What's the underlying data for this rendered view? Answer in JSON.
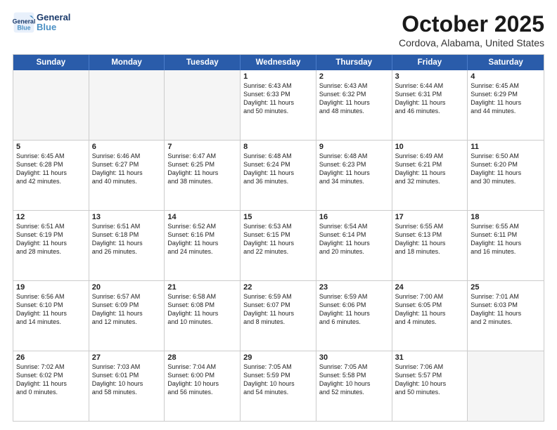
{
  "header": {
    "logo_line1": "General",
    "logo_line2": "Blue",
    "month": "October 2025",
    "location": "Cordova, Alabama, United States"
  },
  "days_of_week": [
    "Sunday",
    "Monday",
    "Tuesday",
    "Wednesday",
    "Thursday",
    "Friday",
    "Saturday"
  ],
  "weeks": [
    [
      {
        "day": "",
        "info": ""
      },
      {
        "day": "",
        "info": ""
      },
      {
        "day": "",
        "info": ""
      },
      {
        "day": "1",
        "info": "Sunrise: 6:43 AM\nSunset: 6:33 PM\nDaylight: 11 hours\nand 50 minutes."
      },
      {
        "day": "2",
        "info": "Sunrise: 6:43 AM\nSunset: 6:32 PM\nDaylight: 11 hours\nand 48 minutes."
      },
      {
        "day": "3",
        "info": "Sunrise: 6:44 AM\nSunset: 6:31 PM\nDaylight: 11 hours\nand 46 minutes."
      },
      {
        "day": "4",
        "info": "Sunrise: 6:45 AM\nSunset: 6:29 PM\nDaylight: 11 hours\nand 44 minutes."
      }
    ],
    [
      {
        "day": "5",
        "info": "Sunrise: 6:45 AM\nSunset: 6:28 PM\nDaylight: 11 hours\nand 42 minutes."
      },
      {
        "day": "6",
        "info": "Sunrise: 6:46 AM\nSunset: 6:27 PM\nDaylight: 11 hours\nand 40 minutes."
      },
      {
        "day": "7",
        "info": "Sunrise: 6:47 AM\nSunset: 6:25 PM\nDaylight: 11 hours\nand 38 minutes."
      },
      {
        "day": "8",
        "info": "Sunrise: 6:48 AM\nSunset: 6:24 PM\nDaylight: 11 hours\nand 36 minutes."
      },
      {
        "day": "9",
        "info": "Sunrise: 6:48 AM\nSunset: 6:23 PM\nDaylight: 11 hours\nand 34 minutes."
      },
      {
        "day": "10",
        "info": "Sunrise: 6:49 AM\nSunset: 6:21 PM\nDaylight: 11 hours\nand 32 minutes."
      },
      {
        "day": "11",
        "info": "Sunrise: 6:50 AM\nSunset: 6:20 PM\nDaylight: 11 hours\nand 30 minutes."
      }
    ],
    [
      {
        "day": "12",
        "info": "Sunrise: 6:51 AM\nSunset: 6:19 PM\nDaylight: 11 hours\nand 28 minutes."
      },
      {
        "day": "13",
        "info": "Sunrise: 6:51 AM\nSunset: 6:18 PM\nDaylight: 11 hours\nand 26 minutes."
      },
      {
        "day": "14",
        "info": "Sunrise: 6:52 AM\nSunset: 6:16 PM\nDaylight: 11 hours\nand 24 minutes."
      },
      {
        "day": "15",
        "info": "Sunrise: 6:53 AM\nSunset: 6:15 PM\nDaylight: 11 hours\nand 22 minutes."
      },
      {
        "day": "16",
        "info": "Sunrise: 6:54 AM\nSunset: 6:14 PM\nDaylight: 11 hours\nand 20 minutes."
      },
      {
        "day": "17",
        "info": "Sunrise: 6:55 AM\nSunset: 6:13 PM\nDaylight: 11 hours\nand 18 minutes."
      },
      {
        "day": "18",
        "info": "Sunrise: 6:55 AM\nSunset: 6:11 PM\nDaylight: 11 hours\nand 16 minutes."
      }
    ],
    [
      {
        "day": "19",
        "info": "Sunrise: 6:56 AM\nSunset: 6:10 PM\nDaylight: 11 hours\nand 14 minutes."
      },
      {
        "day": "20",
        "info": "Sunrise: 6:57 AM\nSunset: 6:09 PM\nDaylight: 11 hours\nand 12 minutes."
      },
      {
        "day": "21",
        "info": "Sunrise: 6:58 AM\nSunset: 6:08 PM\nDaylight: 11 hours\nand 10 minutes."
      },
      {
        "day": "22",
        "info": "Sunrise: 6:59 AM\nSunset: 6:07 PM\nDaylight: 11 hours\nand 8 minutes."
      },
      {
        "day": "23",
        "info": "Sunrise: 6:59 AM\nSunset: 6:06 PM\nDaylight: 11 hours\nand 6 minutes."
      },
      {
        "day": "24",
        "info": "Sunrise: 7:00 AM\nSunset: 6:05 PM\nDaylight: 11 hours\nand 4 minutes."
      },
      {
        "day": "25",
        "info": "Sunrise: 7:01 AM\nSunset: 6:03 PM\nDaylight: 11 hours\nand 2 minutes."
      }
    ],
    [
      {
        "day": "26",
        "info": "Sunrise: 7:02 AM\nSunset: 6:02 PM\nDaylight: 11 hours\nand 0 minutes."
      },
      {
        "day": "27",
        "info": "Sunrise: 7:03 AM\nSunset: 6:01 PM\nDaylight: 10 hours\nand 58 minutes."
      },
      {
        "day": "28",
        "info": "Sunrise: 7:04 AM\nSunset: 6:00 PM\nDaylight: 10 hours\nand 56 minutes."
      },
      {
        "day": "29",
        "info": "Sunrise: 7:05 AM\nSunset: 5:59 PM\nDaylight: 10 hours\nand 54 minutes."
      },
      {
        "day": "30",
        "info": "Sunrise: 7:05 AM\nSunset: 5:58 PM\nDaylight: 10 hours\nand 52 minutes."
      },
      {
        "day": "31",
        "info": "Sunrise: 7:06 AM\nSunset: 5:57 PM\nDaylight: 10 hours\nand 50 minutes."
      },
      {
        "day": "",
        "info": ""
      }
    ]
  ]
}
